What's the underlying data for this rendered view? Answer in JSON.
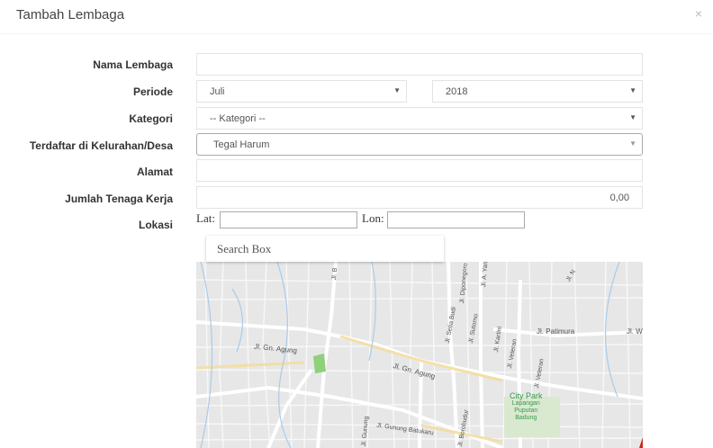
{
  "modal": {
    "title": "Tambah Lembaga",
    "close": "×"
  },
  "form": {
    "nama_lembaga": {
      "label": "Nama Lembaga",
      "value": ""
    },
    "periode": {
      "label": "Periode",
      "month": "Juli",
      "year": "2018"
    },
    "kategori": {
      "label": "Kategori",
      "value": "-- Kategori --"
    },
    "kelurahan": {
      "label": "Terdaftar di Kelurahan/Desa",
      "value": "Tegal Harum"
    },
    "alamat": {
      "label": "Alamat",
      "value": ""
    },
    "tenaga_kerja": {
      "label": "Jumlah Tenaga Kerja",
      "value": "0,00"
    },
    "lokasi": {
      "label": "Lokasi",
      "lat_label": "Lat:",
      "lon_label": "Lon:"
    }
  },
  "map": {
    "search_placeholder": "Search Box",
    "labels": {
      "gn_agung_1": "Jl. Gn. Agung",
      "gn_agung_2": "Jl. Gn. Agung",
      "patimura": "Jl. Patimura",
      "gunung_batukaru": "Jl. Gunung Batukaru",
      "setia_budi": "Jl. Setia Budi",
      "sutomo": "Jl. Sutomo",
      "kartini": "Jl. Kartini",
      "veteran": "Jl. Veteran",
      "veteran_2": "Jl. Veteran",
      "top_b": "Jl. B",
      "top_yani": "Jl. A. Yani",
      "top_n": "Jl. N",
      "top_w": "Jl. W",
      "top_diponegoro": "Jl. Diponegoro",
      "borobudur": "Jl. Borobudur",
      "gunung_left": "Jl. Gunung",
      "city_park": "City Park",
      "lapangan": "Lapangan",
      "puputan": "Puputan",
      "badung": "Badung"
    }
  }
}
